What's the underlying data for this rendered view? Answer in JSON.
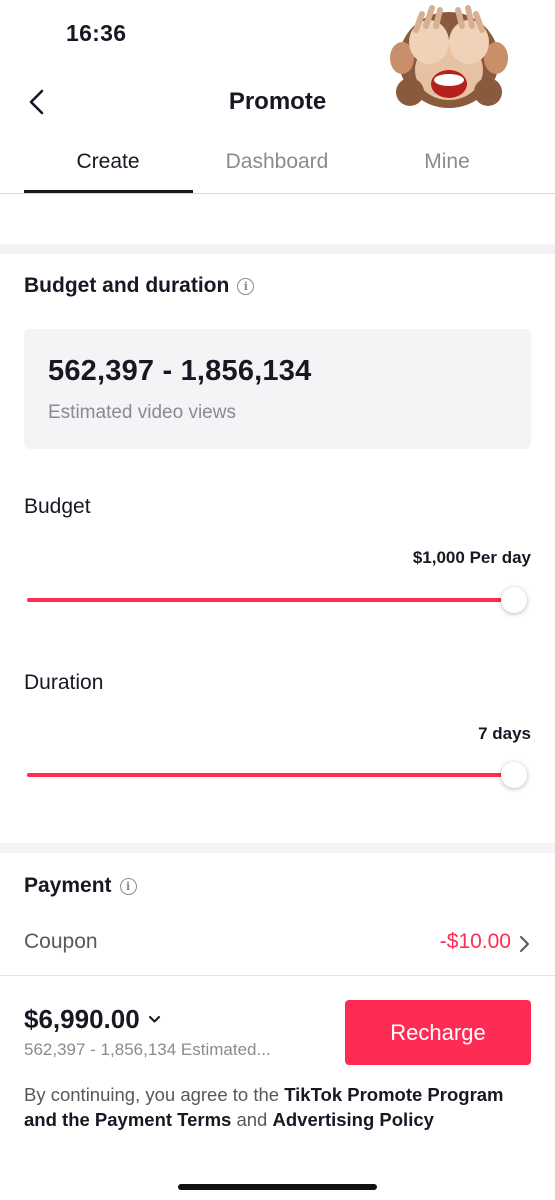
{
  "status_bar": {
    "time": "16:36"
  },
  "header": {
    "title": "Promote"
  },
  "tabs": [
    {
      "label": "Create",
      "active": true
    },
    {
      "label": "Dashboard",
      "active": false
    },
    {
      "label": "Mine",
      "active": false
    }
  ],
  "budget_duration": {
    "title": "Budget and duration",
    "estimate_range": "562,397 - 1,856,134",
    "estimate_label": "Estimated video views",
    "budget": {
      "label": "Budget",
      "value": "$1,000 Per day",
      "slider_fraction": 1.0
    },
    "duration": {
      "label": "Duration",
      "value": "7 days",
      "slider_fraction": 1.0
    }
  },
  "payment": {
    "title": "Payment",
    "coupon_label": "Coupon",
    "coupon_value": "-$10.00"
  },
  "footer": {
    "total": "$6,990.00",
    "estimate": "562,397 - 1,856,134 Estimated...",
    "recharge_label": "Recharge",
    "terms": {
      "prefix": "By continuing, you agree to the ",
      "link1": "TikTok Promote Program and the Payment Terms",
      "middle": " and ",
      "link2": "Advertising Policy"
    }
  },
  "colors": {
    "accent": "#fe2c55",
    "text": "#161823",
    "muted": "#8a8b91",
    "card": "#f4f4f6"
  },
  "icons": [
    "back-arrow-icon",
    "info-icon",
    "chevron-right-icon",
    "chevron-down-icon"
  ]
}
